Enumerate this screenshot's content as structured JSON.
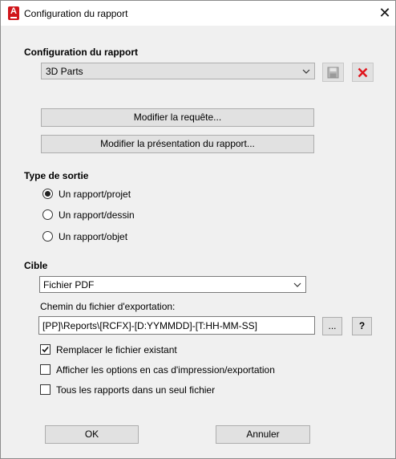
{
  "window": {
    "title": "Configuration du rapport",
    "close_glyph": "✕"
  },
  "app_icon": {
    "letter": "A",
    "name": "autodesk-app-icon"
  },
  "report_config": {
    "label": "Configuration du rapport",
    "selected": "3D Parts",
    "save_icon": "save-icon",
    "delete_icon": "delete-icon",
    "delete_color": "#e0141b"
  },
  "buttons": {
    "modify_query": "Modifier la requête...",
    "modify_layout": "Modifier la présentation du rapport..."
  },
  "output_type": {
    "label": "Type de sortie",
    "options": [
      {
        "label": "Un rapport/projet",
        "selected": true
      },
      {
        "label": "Un rapport/dessin",
        "selected": false
      },
      {
        "label": "Un rapport/objet",
        "selected": false
      }
    ]
  },
  "target": {
    "label": "Cible",
    "selected": "Fichier PDF",
    "path_label": "Chemin du fichier d'exportation:",
    "path_value": "[PP]\\Reports\\[RCFX]-[D:YYMMDD]-[T:HH-MM-SS]",
    "browse_label": "...",
    "help_label": "?"
  },
  "options": [
    {
      "label": "Remplacer le fichier existant",
      "checked": true
    },
    {
      "label": "Afficher les options en cas d'impression/exportation",
      "checked": false
    },
    {
      "label": "Tous les rapports dans un seul fichier",
      "checked": false
    }
  ],
  "footer": {
    "ok": "OK",
    "cancel": "Annuler"
  }
}
